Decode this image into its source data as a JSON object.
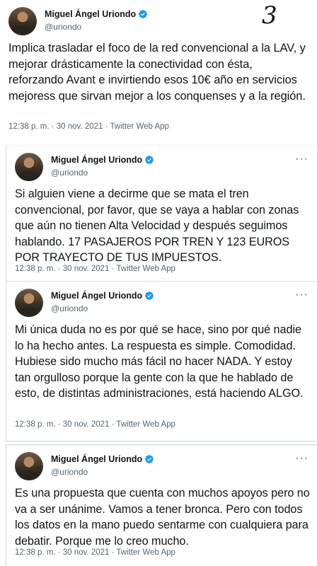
{
  "page_number": "3",
  "author": {
    "name": "Miguel Ángel Uriondo",
    "handle": "@uriondo"
  },
  "icons": {
    "verified": "verified-badge-icon",
    "more": "more-horizontal-icon"
  },
  "colors": {
    "verified_blue": "#1d9bf0",
    "secondary_text": "#536471",
    "divider": "#cfd9de"
  },
  "tweets": [
    {
      "text": "Implica trasladar el foco de la red convencional a la LAV, y mejorar drásticamente la conectividad con ésta, reforzando Avant e invirtiendo esos 10€ año en servicios mejoress que sirvan mejor a los conquenses y a la región.",
      "meta": "12:38 p. m. · 30 nov. 2021 · Twitter Web App",
      "more": "···"
    },
    {
      "text": "Si alguien viene a decirme que se mata el tren convencional, por favor, que se vaya a hablar con zonas que aún no tienen Alta Velocidad y después seguimos hablando. 17 PASAJEROS POR TREN Y 123 EUROS POR TRAYECTO DE TUS IMPUESTOS.",
      "meta": "12:38 p. m. · 30 nov. 2021 · Twitter Web App",
      "more": "···"
    },
    {
      "text": "Mi única duda no es por qué se hace, sino por qué nadie lo ha hecho antes. La respuesta es simple. Comodidad. Hubiese sido mucho más fácil no hacer NADA. Y estoy tan orgulloso porque la gente con la que he hablado de esto, de distintas administraciones, está haciendo ALGO.",
      "meta": "12:38 p. m. · 30 nov. 2021 · Twitter Web App",
      "more": "···"
    },
    {
      "text": "Es una propuesta que cuenta con muchos apoyos pero no va a ser unánime. Vamos a tener bronca. Pero con todos los datos en la mano puedo sentarme con cualquiera para debatir. Porque me lo creo mucho.",
      "meta": "12:38 p. m. · 30 nov. 2021 · Twitter Web App",
      "more": "···"
    }
  ]
}
